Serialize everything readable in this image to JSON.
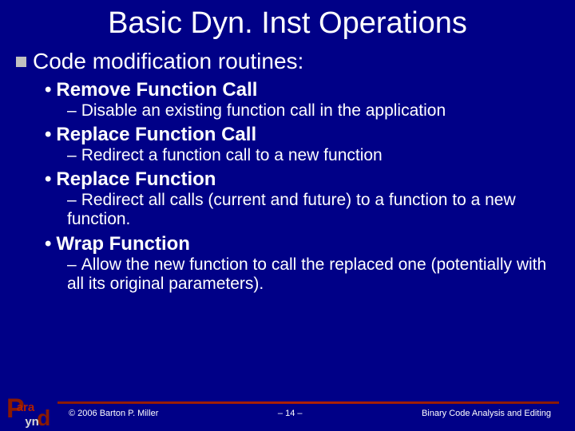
{
  "title": "Basic Dyn. Inst Operations",
  "section_header": "Code modification routines:",
  "items": [
    {
      "name": "Remove Function Call",
      "desc": "Disable an existing function call in the application"
    },
    {
      "name": "Replace Function Call",
      "desc": "Redirect a function call to a new function"
    },
    {
      "name": "Replace Function",
      "desc": "Redirect all calls (current and future) to a function to a new function."
    },
    {
      "name": "Wrap Function",
      "desc": "Allow the new function to call the replaced one (potentially with all its original parameters)."
    }
  ],
  "footer": {
    "copyright": "© 2006 Barton P. Miller",
    "page": "– 14 –",
    "tagline": "Binary Code Analysis and Editing"
  },
  "logo": {
    "p": "P",
    "ara": "ara",
    "d": "d",
    "yn": "yn"
  }
}
